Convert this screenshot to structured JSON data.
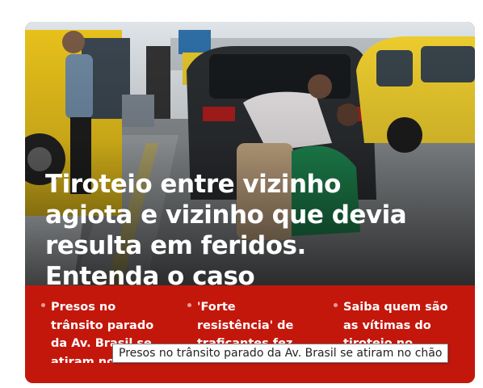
{
  "colors": {
    "accent": "#c4170c",
    "text": "#ffffff",
    "bullet": "#f39a93"
  },
  "story": {
    "headline": "Tiroteio entre vizinho agiota e vizinho que devia resulta em feridos. Entenda o caso",
    "image_icon": "news-photo"
  },
  "related": [
    {
      "title": "Presos no trânsito parado da Av. Brasil se atiram no chão"
    },
    {
      "title": "'Forte resistência' de traficantes fez PM sair do Complexo de Israel"
    },
    {
      "title": "Saiba quem são as vítimas do tiroteio no Complexo de Israel"
    }
  ],
  "tooltip": {
    "text": "Presos no trânsito parado da Av. Brasil se atiram no chão"
  }
}
